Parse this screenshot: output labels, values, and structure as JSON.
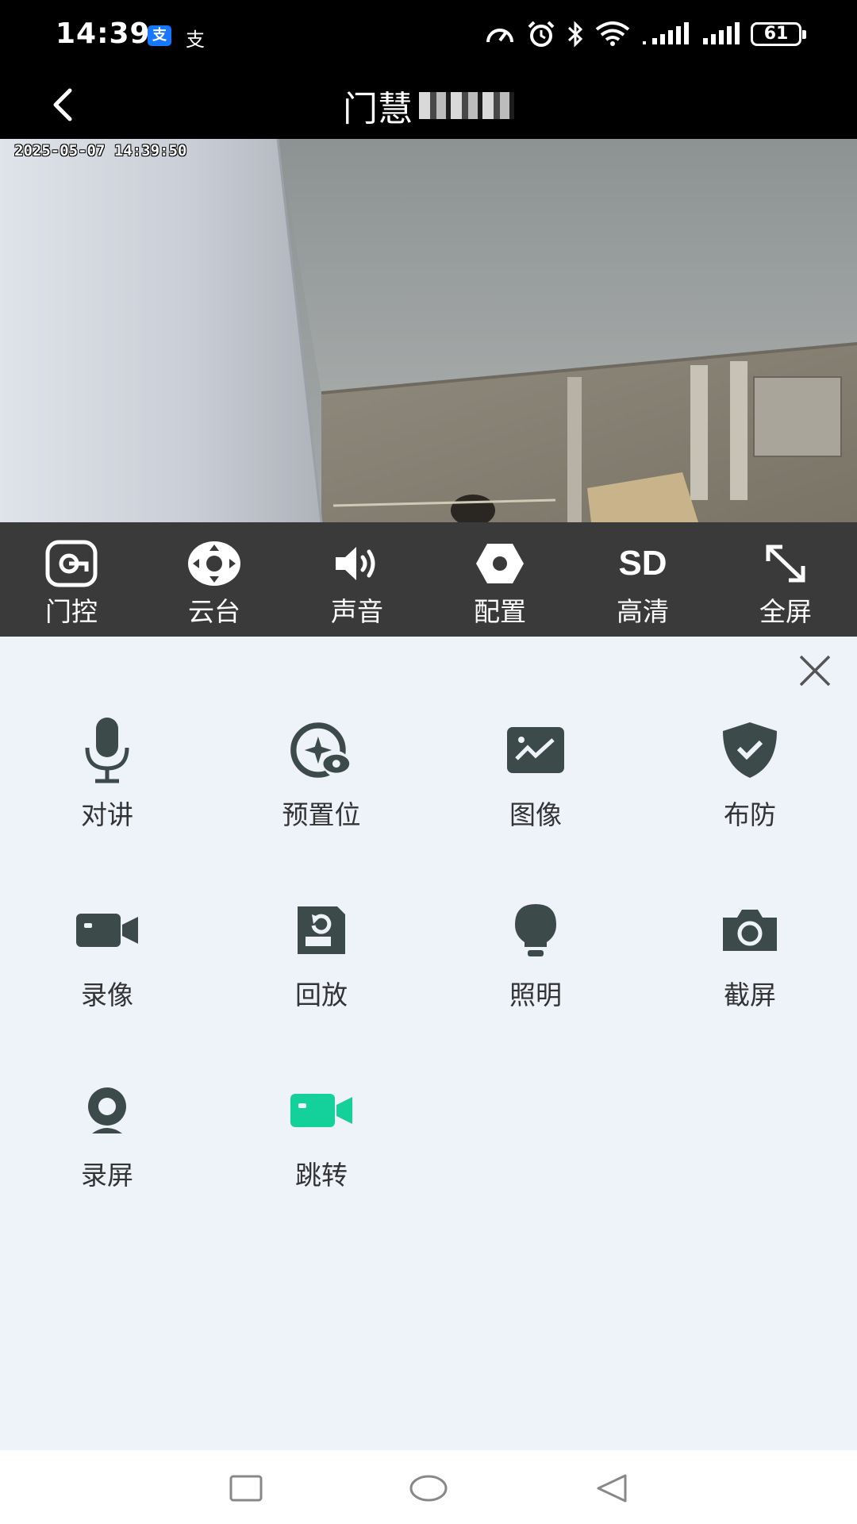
{
  "status_bar": {
    "time": "14:39",
    "alipay_icon_label": "支",
    "alipay_plain_label": "支",
    "battery": "61",
    "icons": [
      "speed-icon",
      "alarm-icon",
      "bluetooth-icon",
      "wifi-icon",
      "signal-icon",
      "signal-icon",
      "battery-icon"
    ]
  },
  "header": {
    "title": "门慧",
    "back_icon": "chevron-left-icon"
  },
  "video": {
    "timestamp": "2025-05-07 14:39:50"
  },
  "toolbar": {
    "items": [
      {
        "label": "门控",
        "icon": "door-control-icon"
      },
      {
        "label": "云台",
        "icon": "ptz-icon"
      },
      {
        "label": "声音",
        "icon": "speaker-icon"
      },
      {
        "label": "配置",
        "icon": "settings-hexagon-icon"
      },
      {
        "label": "高清",
        "icon": "sd-icon",
        "icon_text": "SD"
      },
      {
        "label": "全屏",
        "icon": "fullscreen-icon"
      }
    ]
  },
  "panel": {
    "close_icon": "close-icon",
    "items": [
      {
        "label": "对讲",
        "icon": "microphone-icon"
      },
      {
        "label": "预置位",
        "icon": "preset-icon"
      },
      {
        "label": "图像",
        "icon": "image-icon"
      },
      {
        "label": "布防",
        "icon": "shield-check-icon"
      },
      {
        "label": "录像",
        "icon": "video-camera-icon"
      },
      {
        "label": "回放",
        "icon": "playback-icon"
      },
      {
        "label": "照明",
        "icon": "bulb-icon"
      },
      {
        "label": "截屏",
        "icon": "camera-icon"
      },
      {
        "label": "录屏",
        "icon": "webcam-icon"
      },
      {
        "label": "跳转",
        "icon": "video-camera-green-icon"
      }
    ]
  },
  "colors": {
    "icon_dark": "#3d4a4a",
    "accent_green": "#14d19b",
    "panel_bg": "#eef2f9",
    "toolbar_bg": "#3a3a3a"
  },
  "nav_bar": {
    "buttons": [
      "recents-icon",
      "home-icon",
      "back-triangle-icon"
    ]
  }
}
